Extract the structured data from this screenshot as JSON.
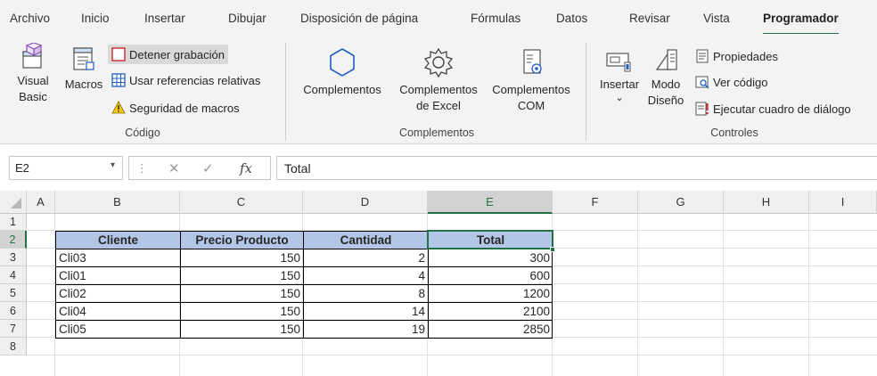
{
  "tabs": [
    "Archivo",
    "Inicio",
    "Insertar",
    "Dibujar",
    "Disposición de página",
    "Fórmulas",
    "Datos",
    "Revisar",
    "Vista",
    "Programador"
  ],
  "ribbon": {
    "codigo": {
      "visual_basic_line1": "Visual",
      "visual_basic_line2": "Basic",
      "macros": "Macros",
      "detener": "Detener grabación",
      "usar_ref": "Usar referencias relativas",
      "seguridad": "Seguridad de macros",
      "group_label": "Código"
    },
    "complementos": {
      "complementos": "Complementos",
      "excel_line1": "Complementos",
      "excel_line2": "de Excel",
      "com_line1": "Complementos",
      "com_line2": "COM",
      "group_label": "Complementos"
    },
    "controles": {
      "insertar": "Insertar",
      "insertar_chevron": "⌄",
      "modo_line1": "Modo",
      "modo_line2": "Diseño",
      "propiedades": "Propiedades",
      "ver_codigo": "Ver código",
      "ejecutar": "Ejecutar cuadro de diálogo",
      "group_label": "Controles"
    }
  },
  "formula_bar": {
    "name_box": "E2",
    "name_box_dropdown": "▾",
    "divider": "⋮",
    "cancel": "✕",
    "enter": "✓",
    "fx": "fx",
    "content": "Total"
  },
  "sheet": {
    "columns": [
      "A",
      "B",
      "C",
      "D",
      "E",
      "F",
      "G",
      "H",
      "I"
    ],
    "rows": [
      "1",
      "2",
      "3",
      "4",
      "5",
      "6",
      "7",
      "8"
    ],
    "table": {
      "headers": [
        "Cliente",
        "Precio Producto",
        "Cantidad",
        "Total"
      ],
      "rows": [
        [
          "Cli03",
          "150",
          "2",
          "300"
        ],
        [
          "Cli01",
          "150",
          "4",
          "600"
        ],
        [
          "Cli02",
          "150",
          "8",
          "1200"
        ],
        [
          "Cli04",
          "150",
          "14",
          "2100"
        ],
        [
          "Cli05",
          "150",
          "19",
          "2850"
        ]
      ]
    }
  },
  "colors": {
    "accent": "#217346",
    "header_fill": "#b4c6e7",
    "ribbon_bg": "#f3f3f3"
  }
}
